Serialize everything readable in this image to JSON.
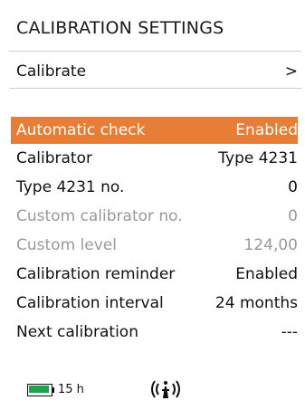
{
  "header": {
    "title": "CALIBRATION SETTINGS"
  },
  "menu": {
    "calibrate": {
      "label": "Calibrate",
      "arrow": ">"
    },
    "rows": [
      {
        "label": "Automatic check",
        "value": "Enabled",
        "state": "selected"
      },
      {
        "label": "Calibrator",
        "value": "Type 4231",
        "state": "normal"
      },
      {
        "label": "Type 4231 no.",
        "value": "0",
        "state": "normal"
      },
      {
        "label": "Custom calibrator no.",
        "value": "0",
        "state": "disabled"
      },
      {
        "label": "Custom level",
        "value": "124,00",
        "state": "disabled"
      },
      {
        "label": "Calibration reminder",
        "value": "Enabled",
        "state": "normal"
      },
      {
        "label": "Calibration interval",
        "value": "24 months",
        "state": "normal"
      },
      {
        "label": "Next calibration",
        "value": "---",
        "state": "normal"
      }
    ]
  },
  "status": {
    "battery_icon": "battery-icon",
    "battery_color": "#1fa34a",
    "battery_level": 1.0,
    "battery_time": "15 h",
    "signal_icon": "wireless-signal-icon"
  },
  "colors": {
    "highlight": "#e87e36",
    "disabled_text": "#9a9a9a"
  }
}
